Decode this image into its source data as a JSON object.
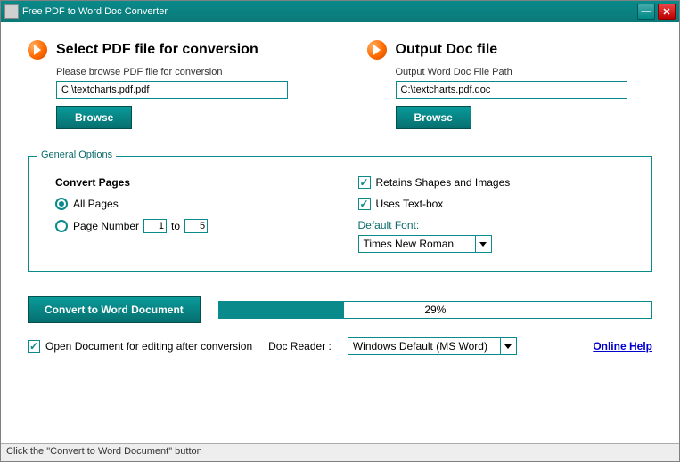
{
  "title": "Free PDF to Word Doc Converter",
  "input": {
    "heading": "Select PDF file for conversion",
    "sub": "Please browse PDF file for conversion",
    "path": "C:\\textcharts.pdf.pdf",
    "browse": "Browse"
  },
  "output": {
    "heading": "Output Doc file",
    "sub": "Output Word Doc File Path",
    "path": "C:\\textcharts.pdf.doc",
    "browse": "Browse"
  },
  "options": {
    "legend": "General Options",
    "pages_title": "Convert Pages",
    "all_pages": "All Pages",
    "page_number": "Page Number",
    "from": "1",
    "to_label": "to",
    "to": "5",
    "retain_shapes": "Retains Shapes and Images",
    "uses_textbox": "Uses Text-box",
    "default_font_label": "Default Font:",
    "default_font": "Times New Roman"
  },
  "convert_label": "Convert to Word Document",
  "progress_text": "29%",
  "progress_pct": 29,
  "open_after": "Open Document for editing after conversion",
  "doc_reader_label": "Doc Reader :",
  "doc_reader": "Windows Default (MS Word)",
  "help": "Online Help",
  "status": "Click the \"Convert to Word Document\" button"
}
